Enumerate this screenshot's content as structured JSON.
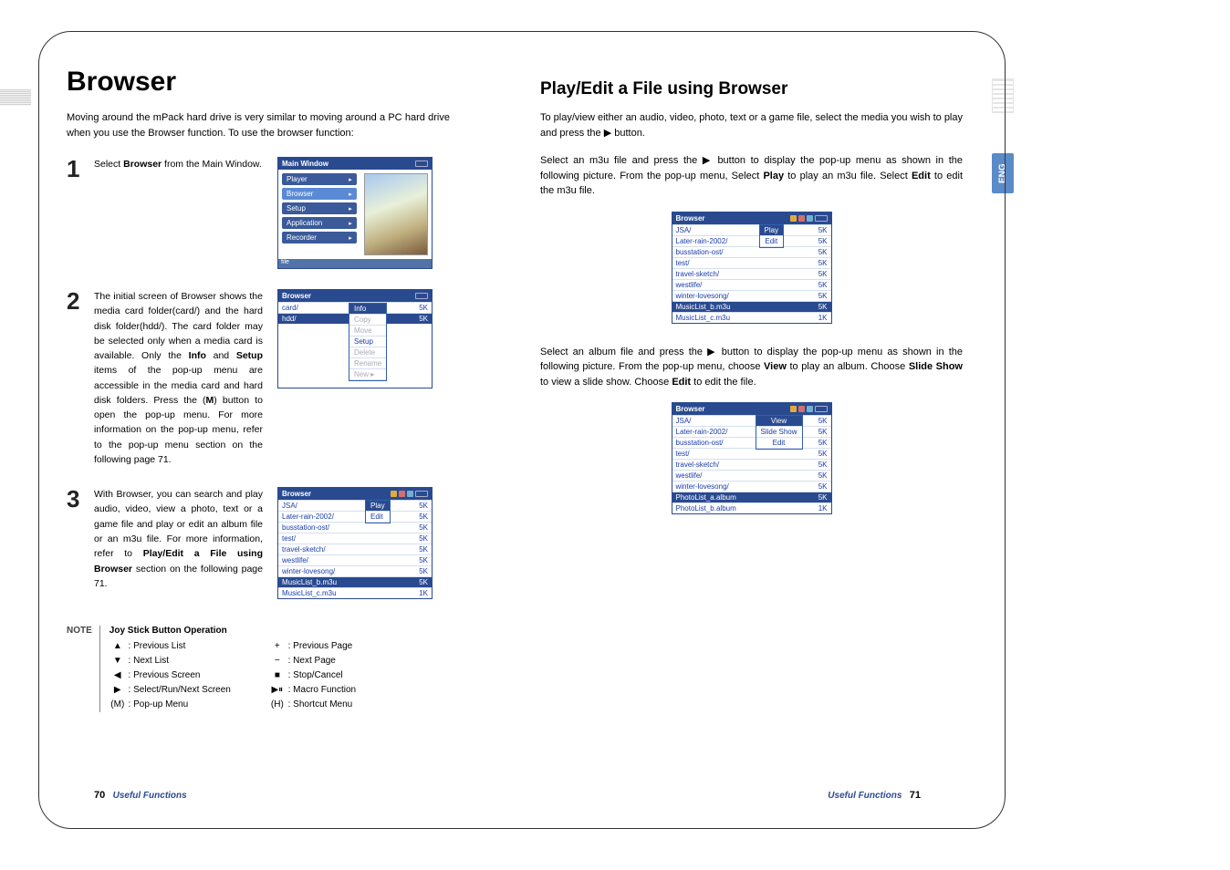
{
  "lang_tab": "ENG",
  "left": {
    "title": "Browser",
    "intro": "Moving around the mPack hard drive is very similar to moving around a PC hard drive when you use the Browser function. To use the browser function:",
    "steps": [
      {
        "num": "1",
        "text_html": "Select <b>Browser</b> from the Main Window."
      },
      {
        "num": "2",
        "text_html": "The initial screen of Browser shows the media card folder(card/) and the hard disk folder(hdd/). The card folder may be selected only when a media card is available. Only the <b>Info</b> and <b>Setup</b> items of the pop-up menu are accessible in the media card and hard disk folders. Press the (<b>M</b>) button to open the pop-up menu. For more information on the pop-up menu, refer to the pop-up menu section on the following page 71."
      },
      {
        "num": "3",
        "text_html": "With Browser, you can search and play audio, video, view a photo, text or a game file and play or edit an album file or an m3u file. For more information, refer to <b>Play/Edit a File using Browser</b> section on the following page 71."
      }
    ],
    "main_window": {
      "title": "Main Window",
      "items": [
        "Player",
        "Browser",
        "Setup",
        "Application",
        "Recorder"
      ],
      "selected": "Browser",
      "footer_icon": "file"
    },
    "browser2": {
      "title": "Browser",
      "rows": [
        {
          "name": "card/",
          "size": "5K"
        },
        {
          "name": "hdd/",
          "size": "5K",
          "hi": true
        }
      ],
      "popup": [
        {
          "label": "Info",
          "hi": true
        },
        {
          "label": "Copy",
          "dis": true
        },
        {
          "label": "Move",
          "dis": true
        },
        {
          "label": "Setup"
        },
        {
          "label": "Delete",
          "dis": true
        },
        {
          "label": "Rename",
          "dis": true
        },
        {
          "label": "New  ▸",
          "dis": true
        }
      ]
    },
    "browser3": {
      "title": "Browser",
      "rows": [
        {
          "name": "JSA/",
          "size": "5K"
        },
        {
          "name": "Later-rain-2002/",
          "size": "5K"
        },
        {
          "name": "busstation-ost/",
          "size": "5K"
        },
        {
          "name": "test/",
          "size": "5K"
        },
        {
          "name": "travel-sketch/",
          "size": "5K"
        },
        {
          "name": "westlife/",
          "size": "5K"
        },
        {
          "name": "winter-lovesong/",
          "size": "5K"
        },
        {
          "name": "MusicList_b.m3u",
          "size": "5K",
          "hi": true
        },
        {
          "name": "MusicList_c.m3u",
          "size": "1K"
        }
      ],
      "popup": [
        {
          "label": "Play",
          "hi": true
        },
        {
          "label": "Edit"
        }
      ]
    },
    "note": {
      "label": "NOTE",
      "title": "Joy Stick Button Operation",
      "col1": [
        {
          "sym": "▲",
          "txt": ": Previous List"
        },
        {
          "sym": "▼",
          "txt": ": Next List"
        },
        {
          "sym": "◀",
          "txt": ": Previous Screen"
        },
        {
          "sym": "▶",
          "txt": ": Select/Run/Next Screen"
        },
        {
          "sym": "(M)",
          "txt": ": Pop-up Menu"
        }
      ],
      "col2": [
        {
          "sym": "+",
          "txt": ": Previous Page"
        },
        {
          "sym": "−",
          "txt": ": Next Page"
        },
        {
          "sym": "■",
          "txt": ": Stop/Cancel"
        },
        {
          "sym": "▶⏸",
          "txt": ": Macro Function"
        },
        {
          "sym": "(H)",
          "txt": ": Shortcut Menu"
        }
      ]
    },
    "footer": {
      "page": "70",
      "section": "Useful Functions"
    }
  },
  "right": {
    "title": "Play/Edit a File using Browser",
    "p1_html": "To play/view either an audio, video, photo, text or a game file, select the media you wish to play and press the ▶ button.",
    "p2_html": "Select an m3u file and press the ▶ button to display the pop-up menu as shown in the following picture. From the pop-up menu, Select <b>Play</b> to play an m3u file. Select <b>Edit</b> to edit the m3u file.",
    "p3_html": "Select an album file and press the ▶ button to display the pop-up menu as shown in the following picture. From the pop-up menu, choose <b>View</b> to play an album. Choose <b>Slide Show</b> to view a slide show. Choose <b>Edit</b> to edit the file.",
    "browserA": {
      "title": "Browser",
      "rows": [
        {
          "name": "JSA/",
          "size": "5K"
        },
        {
          "name": "Later-rain-2002/",
          "size": "5K"
        },
        {
          "name": "busstation-ost/",
          "size": "5K"
        },
        {
          "name": "test/",
          "size": "5K"
        },
        {
          "name": "travel-sketch/",
          "size": "5K"
        },
        {
          "name": "westlife/",
          "size": "5K"
        },
        {
          "name": "winter-lovesong/",
          "size": "5K"
        },
        {
          "name": "MusicList_b.m3u",
          "size": "5K",
          "hi": true
        },
        {
          "name": "MusicList_c.m3u",
          "size": "1K"
        }
      ],
      "popup": [
        {
          "label": "Play",
          "hi": true
        },
        {
          "label": "Edit"
        }
      ]
    },
    "browserB": {
      "title": "Browser",
      "rows": [
        {
          "name": "JSA/",
          "size": "5K"
        },
        {
          "name": "Later-rain-2002/",
          "size": "5K"
        },
        {
          "name": "busstation-ost/",
          "size": "5K"
        },
        {
          "name": "test/",
          "size": "5K"
        },
        {
          "name": "travel-sketch/",
          "size": "5K"
        },
        {
          "name": "westlife/",
          "size": "5K"
        },
        {
          "name": "winter-lovesong/",
          "size": "5K"
        },
        {
          "name": "PhotoList_a.album",
          "size": "5K",
          "hi": true
        },
        {
          "name": "PhotoList_b.album",
          "size": "1K"
        }
      ],
      "popup": [
        {
          "label": "View",
          "hi": true
        },
        {
          "label": "Slide Show"
        },
        {
          "label": "Edit"
        }
      ]
    },
    "footer": {
      "page": "71",
      "section": "Useful Functions"
    }
  }
}
